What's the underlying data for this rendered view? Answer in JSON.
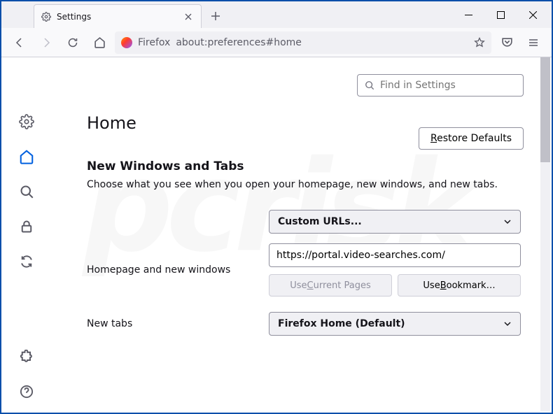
{
  "tab": {
    "title": "Settings"
  },
  "urlbar": {
    "label": "Firefox",
    "address": "about:preferences#home"
  },
  "search": {
    "placeholder": "Find in Settings"
  },
  "page": {
    "title": "Home",
    "restore_pre": "R",
    "restore_post": "estore Defaults",
    "section": "New Windows and Tabs",
    "desc": "Choose what you see when you open your homepage, new windows, and new tabs."
  },
  "homepage": {
    "label": "Homepage and new windows",
    "select": "Custom URLs...",
    "url": "https://portal.video-searches.com/",
    "use_current_pre": "Use ",
    "use_current_mid": "C",
    "use_current_post": "urrent Pages",
    "use_bookmark_pre": "Use ",
    "use_bookmark_mid": "B",
    "use_bookmark_post": "ookmark…"
  },
  "newtabs": {
    "label": "New tabs",
    "select": "Firefox Home (Default)"
  }
}
